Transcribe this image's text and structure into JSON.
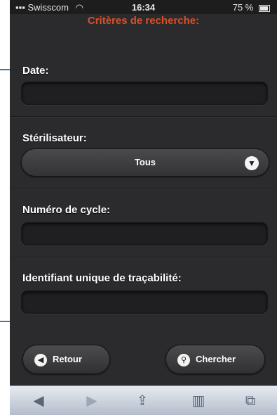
{
  "status_bar": {
    "carrier": "Swisscom",
    "time": "16:34",
    "battery": "75 %"
  },
  "header": {
    "title": "Critères de recherche:"
  },
  "form": {
    "date": {
      "label": "Date:",
      "value": ""
    },
    "sterilisateur": {
      "label": "Stérilisateur:",
      "selected": "Tous"
    },
    "numero_cycle": {
      "label": "Numéro de cycle:",
      "value": ""
    },
    "identifiant": {
      "label": "Identifiant unique de traçabilité:",
      "value": ""
    }
  },
  "buttons": {
    "back_label": "Retour",
    "search_label": "Chercher"
  },
  "toolbar": {
    "items": [
      "back-arrow-icon",
      "forward-arrow-icon",
      "share-icon",
      "bookmarks-icon",
      "tabs-icon"
    ]
  },
  "colors": {
    "header_title": "#d8502a",
    "background": "#2b2b2d",
    "callout": "#3c79a8"
  }
}
